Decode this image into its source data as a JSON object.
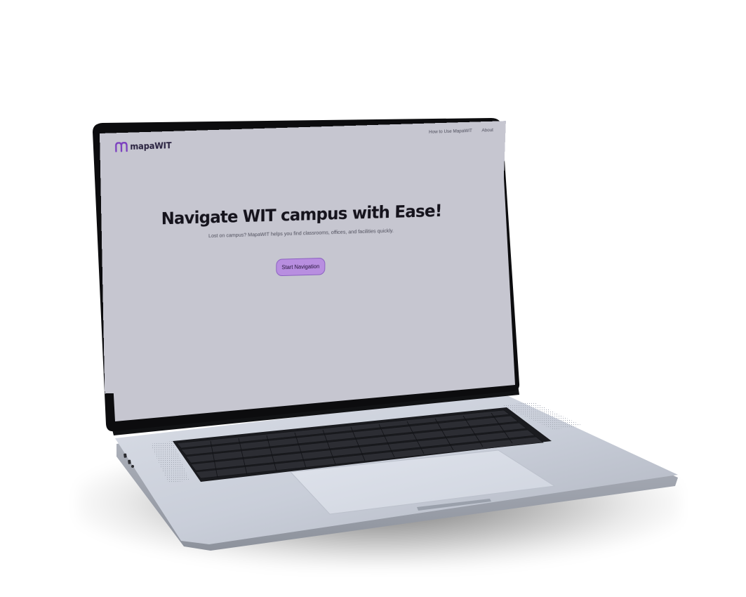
{
  "site": {
    "brand_name": "mapaWIT",
    "brand_icon": "m-logo-icon",
    "accent_color": "#7b3fbf",
    "screen_bg": "#c6c6d0"
  },
  "nav": {
    "links": [
      {
        "label": "How to Use MapaWIT"
      },
      {
        "label": "About"
      }
    ]
  },
  "hero": {
    "title": "Navigate WIT campus with Ease!",
    "subtitle": "Lost on campus? MapaWIT helps you find classrooms, offices, and facilities quickly.",
    "cta_label": "Start Navigation",
    "cta_color": "#b88ee0"
  }
}
